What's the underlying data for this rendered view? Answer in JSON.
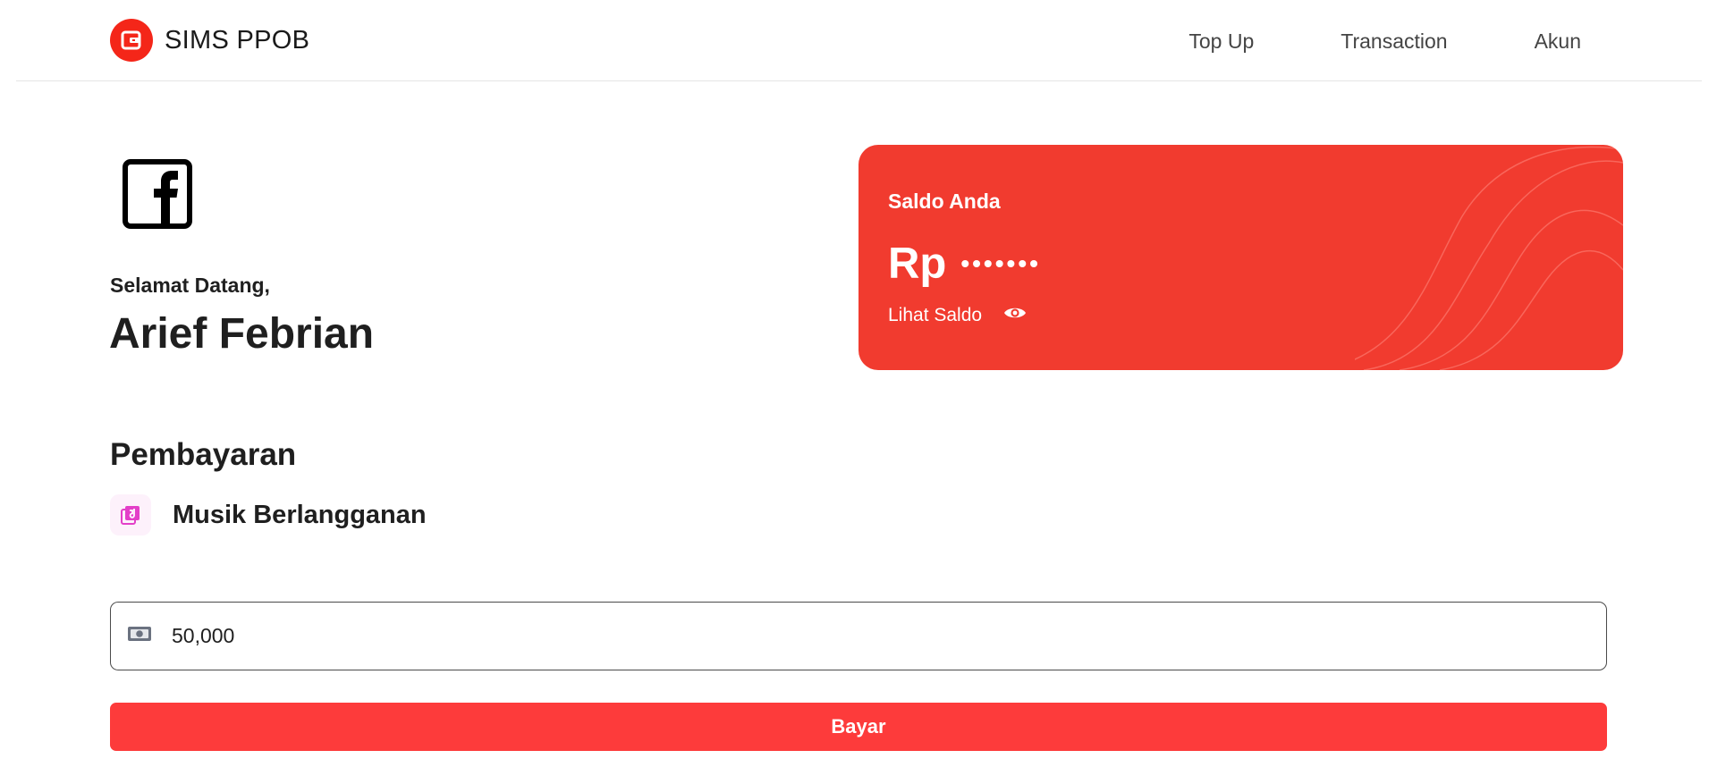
{
  "header": {
    "brand_name": "SIMS PPOB",
    "nav": [
      {
        "label": "Top Up"
      },
      {
        "label": "Transaction"
      },
      {
        "label": "Akun"
      }
    ]
  },
  "profile": {
    "avatar_icon": "facebook-icon",
    "welcome": "Selamat Datang,",
    "name": "Arief Febrian"
  },
  "balance": {
    "label": "Saldo Anda",
    "currency": "Rp",
    "masked_value": "•••••••",
    "toggle_label": "Lihat Saldo",
    "toggle_icon": "eye-icon",
    "card_color": "#f13b2f"
  },
  "payment": {
    "title": "Pembayaran",
    "service_name": "Musik Berlangganan",
    "service_icon": "music-icon",
    "amount_value": "50,000",
    "amount_icon": "money-icon",
    "pay_label": "Bayar",
    "button_color": "#fd3b3b"
  }
}
